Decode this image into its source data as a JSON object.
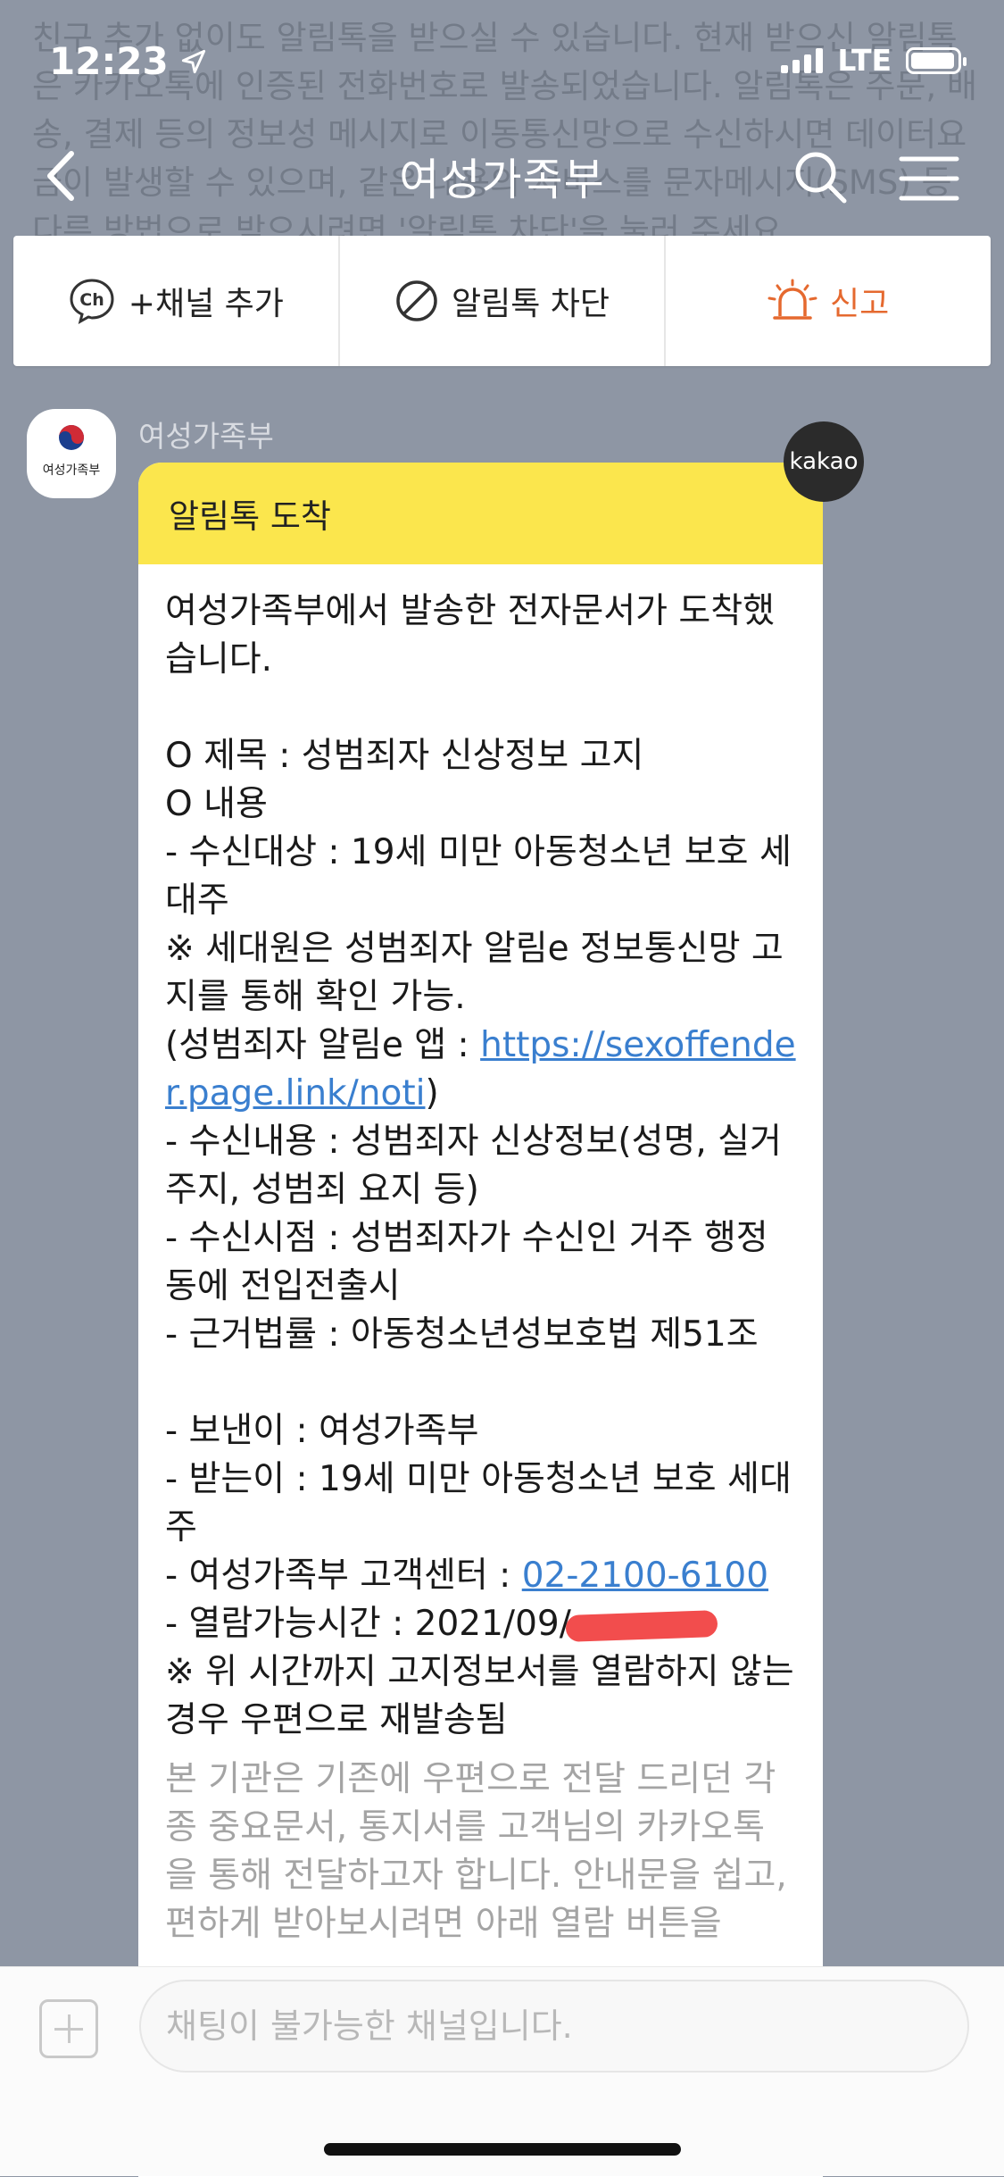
{
  "background_notice": "친구 추가 없이도 알림톡을 받으실 수 있습니다. 현재 받으신 알림톡은 카카오톡에 인증된 전화번호로 발송되었습니다. 알림톡은 주문, 배송, 결제 등의 정보성 메시지로 이동통신망으로 수신하시면 데이터요금이 발생할 수 있으며, 같은 내용의 서비스를 문자메시지(SMS) 등 다른 방법으로 받으시려면 '알림톡 차단'을 눌러 주세요.",
  "status_bar": {
    "time": "12:23",
    "network": "LTE"
  },
  "nav": {
    "title": "여성가족부"
  },
  "actions": {
    "add_channel": "+채널 추가",
    "add_channel_icon": "Ch",
    "block": "알림톡 차단",
    "report": "신고"
  },
  "message": {
    "sender": "여성가족부",
    "avatar_label": "여성가족부",
    "badge": "kakao",
    "header": "알림톡 도착",
    "lines": [
      "여성가족부에서 발송한 전자문서가 도착했습니다.",
      "",
      "O 제목 : 성범죄자 신상정보 고지",
      "O 내용",
      " - 수신대상 : 19세 미만 아동청소년 보호 세대주",
      " ※ 세대원은 성범죄자 알림e 정보통신망 고지를 통해 확인 가능.",
      " (성범죄자 알림e 앱 : ",
      "https://sexoffender.page.link/noti",
      ")",
      " - 수신내용 : 성범죄자 신상정보(성명, 실거주지, 성범죄 요지 등)",
      " - 수신시점 : 성범죄자가 수신인 거주 행정동에 전입전출시",
      " - 근거법률 : 아동청소년성보호법 제51조",
      "",
      "- 보낸이 : 여성가족부",
      "- 받는이 : 19세 미만 아동청소년 보호 세대주",
      "- 여성가족부 고객센터 : ",
      "02-2100-6100",
      "- 열람가능시간 : 2021/09/",
      "※ 위 시간까지 고지정보서를 열람하지 않는 경우 우편으로 재발송됨",
      "본 기관은 기존에 우편으로 전달 드리던 각종 중요문서, 통지서를 고객님의 카카오톡을 통해 전달하고자 합니다. 안내문을 쉽고, 편하게 받아보시려면 아래 열람 버튼을"
    ]
  },
  "input": {
    "placeholder": "채팅이 불가능한 채널입니다."
  },
  "colors": {
    "background": "#8e96a4",
    "header_yellow": "#fbe64d",
    "link": "#3a7fcf",
    "report": "#e5692f",
    "redaction": "#f24d4d"
  },
  "icons": [
    "location-arrow-icon",
    "signal-icon",
    "battery-icon",
    "back-icon",
    "search-icon",
    "menu-icon",
    "channel-icon",
    "block-icon",
    "siren-icon",
    "plus-icon"
  ]
}
